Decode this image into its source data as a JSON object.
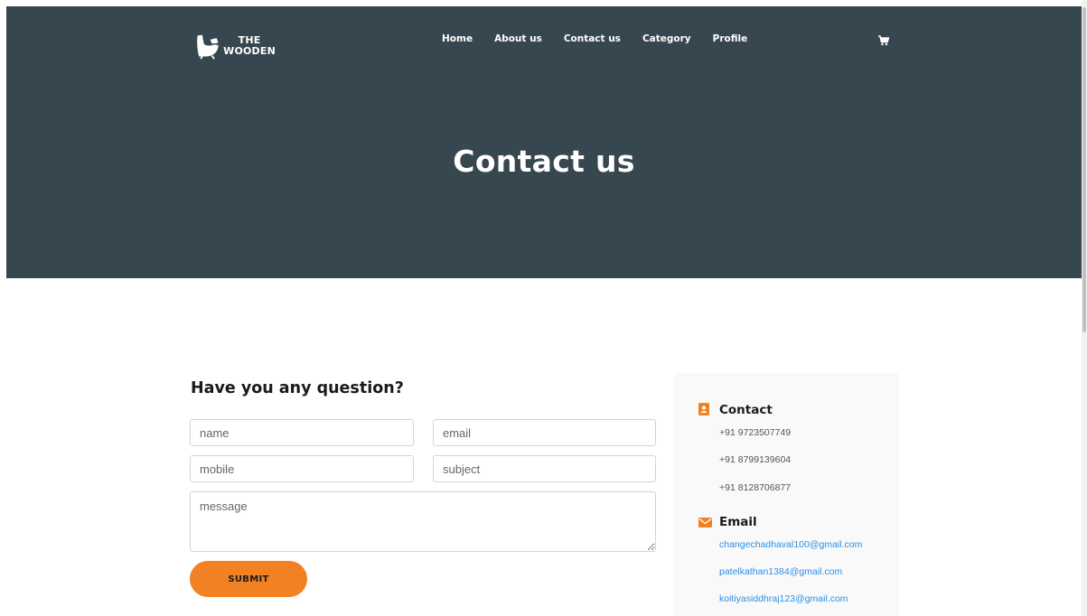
{
  "brand": {
    "line1": "THE",
    "line2": "WOODEN"
  },
  "nav": {
    "items": [
      "Home",
      "About us",
      "Contact us",
      "Category",
      "Profile"
    ]
  },
  "hero": {
    "title": "Contact us"
  },
  "form": {
    "heading": "Have you any question?",
    "name_placeholder": "name",
    "email_placeholder": "email",
    "mobile_placeholder": "mobile",
    "subject_placeholder": "subject",
    "message_placeholder": "message",
    "submit_label": "SUBMIT"
  },
  "info": {
    "contact_heading": "Contact",
    "phones": [
      "+91 9723507749",
      "+91 8799139604",
      "+91 8128706877"
    ],
    "email_heading": "Email",
    "emails": [
      "changechadhaval100@gmail.com",
      "patelkathan1384@gmail.com",
      "koitiyasiddhraj123@gmail.com"
    ]
  },
  "colors": {
    "hero_bg": "#37474f",
    "accent": "#f28123",
    "link": "#2a90e6"
  },
  "icons": {
    "cart": "cart-icon",
    "contact": "address-book-icon",
    "email": "envelope-icon"
  }
}
